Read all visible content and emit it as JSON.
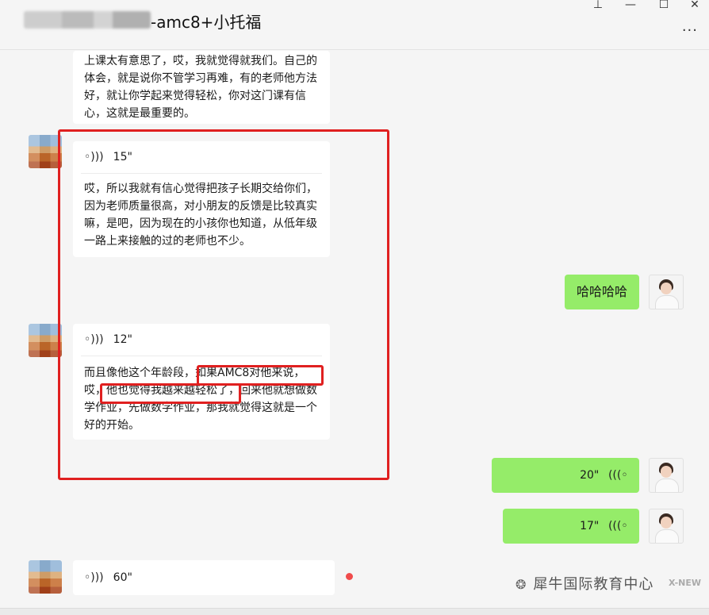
{
  "window": {
    "title": "-amc8+小托福",
    "controls": {
      "pin": "⊥",
      "minimize": "—",
      "maximize": "☐",
      "close": "✕"
    },
    "more": "···"
  },
  "messages": {
    "m0_text": "上课太有意思了，哎，我就觉得就我们。自己的体会，就是说你不管学习再难，有的老师他方法好，就让你学起来觉得轻松，你对这门课有信心，这就是最重要的。",
    "m1_duration": "15\"",
    "m1_text": "哎，所以我就有信心觉得把孩子长期交给你们，因为老师质量很高，对小朋友的反馈是比较真实嘛，是吧，因为现在的小孩你也知道，从低年级一路上来接触的过的老师也不少。",
    "m2_text": "哈哈哈哈",
    "m3_duration": "12\"",
    "m3_text_a": "而且像他这个年龄段，",
    "m3_text_b": "如果AMC8对他来说，",
    "m3_text_c": "哎，",
    "m3_text_d": "他也觉得我越来越轻松了",
    "m3_text_e": "，回来他就想做数学作业，先做数学作业，那我就觉得这就是一个好的开始。",
    "m4_duration": "20\"",
    "m5_duration": "17\"",
    "m6_duration": "60\""
  },
  "watermark": {
    "text": "犀牛国际教育中心",
    "logo": "X-NEW"
  },
  "colors": {
    "self_bubble": "#95ec69",
    "other_bubble": "#ffffff",
    "highlight": "#e02020"
  }
}
